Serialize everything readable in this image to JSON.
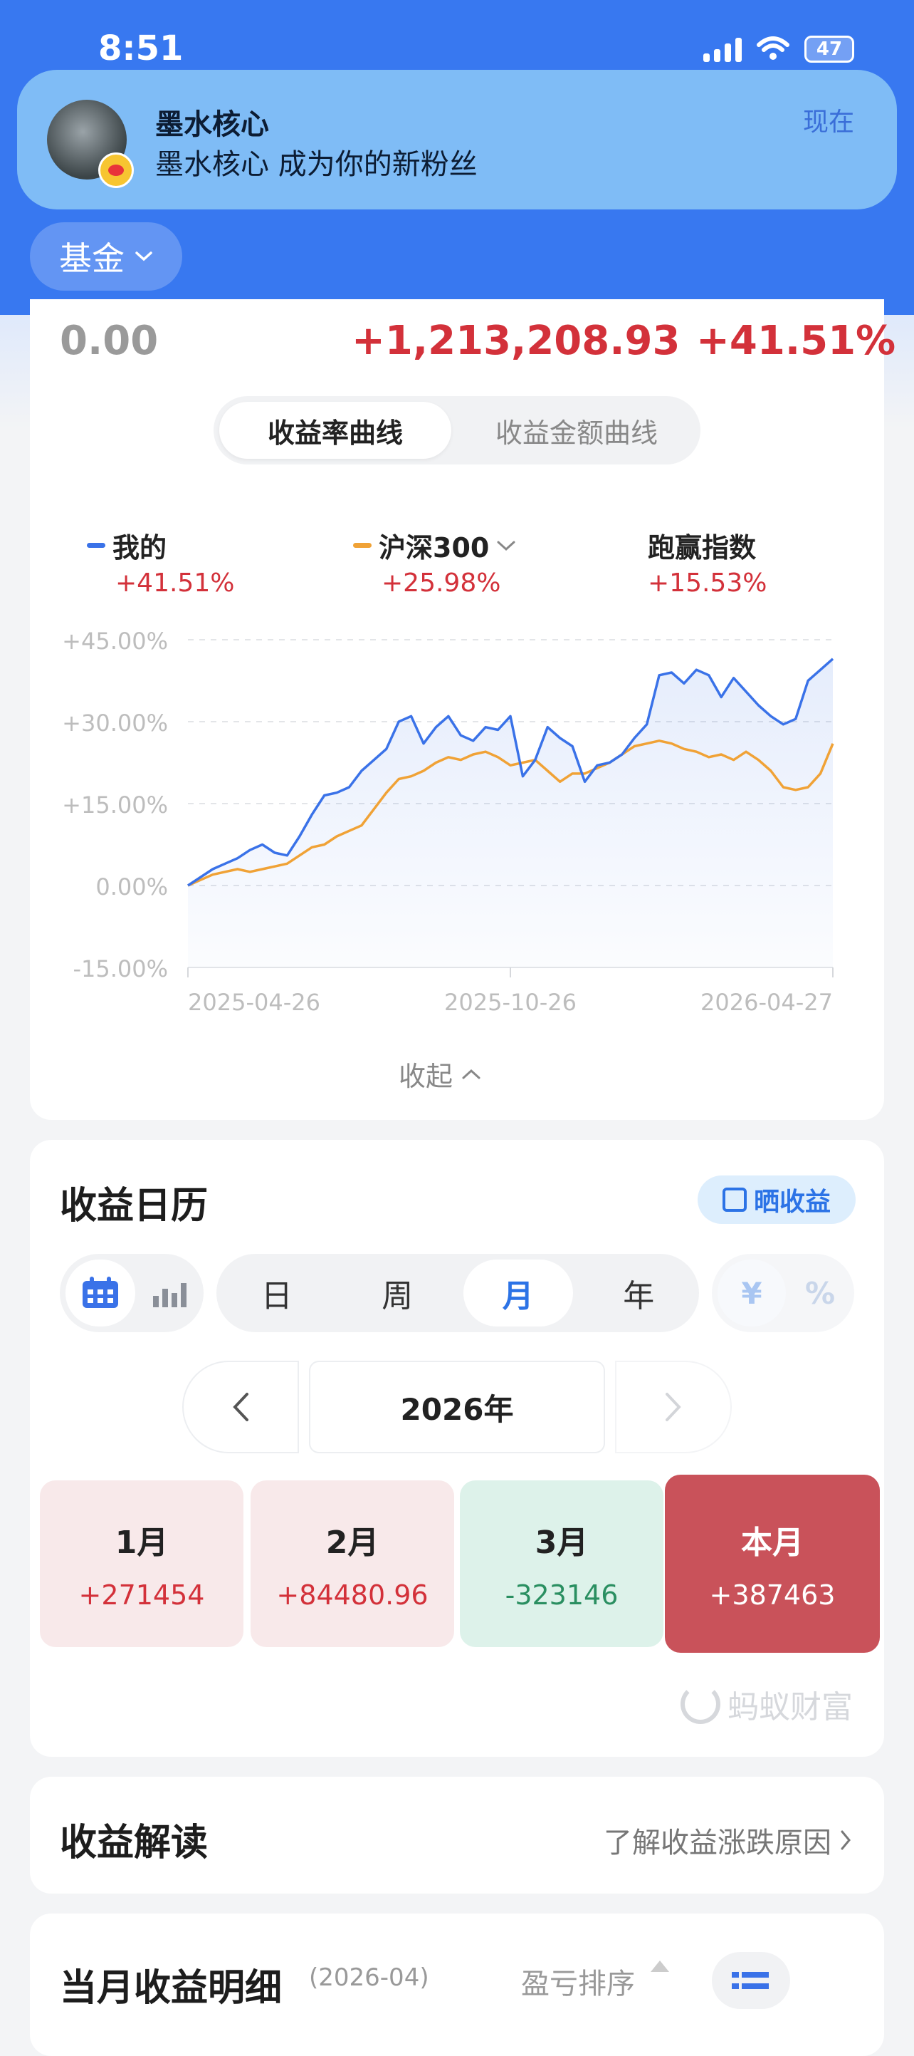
{
  "status_bar": {
    "time": "8:51",
    "battery": "47"
  },
  "notification": {
    "title": "墨水核心",
    "body": "墨水核心 成为你的新粉丝",
    "time": "现在"
  },
  "fund_selector": {
    "label": "基金"
  },
  "summary": {
    "value_left": "0.00",
    "profit": "+1,213,208.93",
    "rate": "+41.51%"
  },
  "curve_toggle": {
    "active": "收益率曲线",
    "inactive": "收益金额曲线"
  },
  "legend": [
    {
      "name": "我的",
      "value": "+41.51%",
      "color": "#3a72e8"
    },
    {
      "name": "沪深300",
      "value": "+25.98%",
      "color": "#f0a236"
    },
    {
      "name": "跑赢指数",
      "value": "+15.53%"
    }
  ],
  "chart_data": {
    "type": "line",
    "ylim": [
      -15,
      45
    ],
    "y_ticks": [
      "+45.00%",
      "+30.00%",
      "+15.00%",
      "0.00%",
      "-15.00%"
    ],
    "x_ticks": [
      "2025-04-26",
      "2025-10-26",
      "2026-04-27"
    ],
    "series": [
      {
        "name": "我的",
        "color": "#3a72e8",
        "values": [
          0,
          1.5,
          3,
          4,
          5,
          6.5,
          7.5,
          6,
          5.5,
          9,
          13,
          16.5,
          17,
          18,
          21,
          23,
          25,
          30,
          31,
          26,
          29,
          31,
          27.5,
          26.5,
          29,
          28.5,
          31,
          20,
          23,
          29,
          27,
          25.5,
          19,
          22,
          22.5,
          24,
          27,
          29.5,
          38.5,
          39,
          37,
          39.5,
          38.5,
          34.5,
          38,
          35.5,
          33,
          31,
          29.5,
          30.5,
          37.5,
          39.5,
          41.51
        ]
      },
      {
        "name": "沪深300",
        "color": "#f0a236",
        "values": [
          0,
          1,
          2,
          2.5,
          3,
          2.5,
          3,
          3.5,
          4,
          5.5,
          7,
          7.5,
          9,
          10,
          11,
          14,
          17,
          19.5,
          20,
          21,
          22.5,
          23.5,
          23,
          24,
          24.5,
          23.5,
          22,
          22.5,
          23,
          21,
          19,
          20.5,
          20.5,
          21.5,
          22.5,
          24,
          25.5,
          26,
          26.5,
          26,
          25,
          24.5,
          23.5,
          24,
          23,
          24.5,
          23,
          21,
          18,
          17.5,
          18,
          20.5,
          25.98
        ]
      }
    ]
  },
  "collapse_label": "收起",
  "calendar": {
    "title": "收益日历",
    "share_label": "晒收益",
    "periods": [
      "日",
      "周",
      "月",
      "年"
    ],
    "active_period": "月",
    "units": [
      "¥",
      "%"
    ],
    "year": "2026年",
    "months": [
      {
        "name": "1月",
        "value": "+271454",
        "trend": "up"
      },
      {
        "name": "2月",
        "value": "+84480.96",
        "trend": "up"
      },
      {
        "name": "3月",
        "value": "-323146",
        "trend": "down"
      },
      {
        "name": "本月",
        "value": "+387463",
        "trend": "current"
      }
    ],
    "brand": "蚂蚁财富"
  },
  "explain": {
    "title": "收益解读",
    "link": "了解收益涨跌原因"
  },
  "detail": {
    "title": "当月收益明细",
    "date": "(2026-04)",
    "sort_label": "盈亏排序"
  }
}
